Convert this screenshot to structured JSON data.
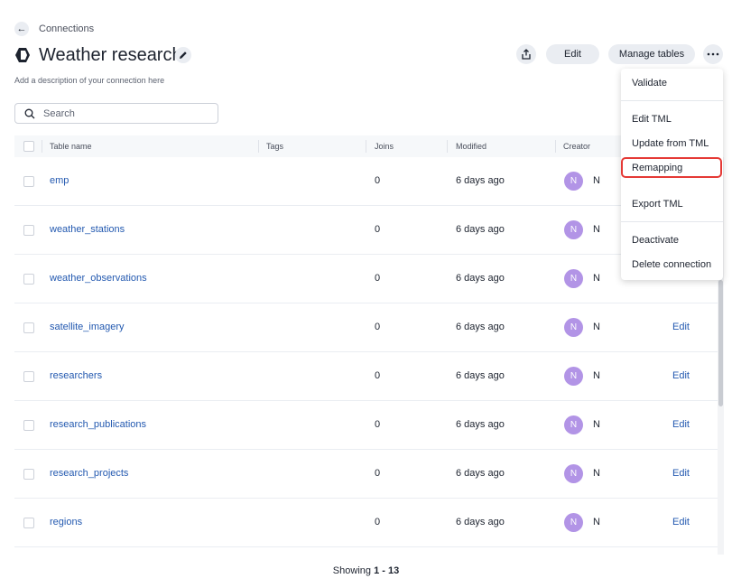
{
  "breadcrumb": {
    "label": "Connections"
  },
  "header": {
    "title": "Weather research",
    "description": "Add a description of your connection here"
  },
  "search": {
    "placeholder": "Search",
    "value": ""
  },
  "actions": {
    "edit_label": "Edit",
    "manage_tables_label": "Manage tables"
  },
  "table": {
    "columns": {
      "name": "Table name",
      "tags": "Tags",
      "joins": "Joins",
      "modified": "Modified",
      "creator": "Creator"
    },
    "rows": [
      {
        "name": "emp",
        "joins": "0",
        "modified": "6 days ago",
        "creator_initial": "N",
        "creator": "N",
        "action": ""
      },
      {
        "name": "weather_stations",
        "joins": "0",
        "modified": "6 days ago",
        "creator_initial": "N",
        "creator": "N",
        "action": ""
      },
      {
        "name": "weather_observations",
        "joins": "0",
        "modified": "6 days ago",
        "creator_initial": "N",
        "creator": "N",
        "action": ""
      },
      {
        "name": "satellite_imagery",
        "joins": "0",
        "modified": "6 days ago",
        "creator_initial": "N",
        "creator": "N",
        "action": "Edit"
      },
      {
        "name": "researchers",
        "joins": "0",
        "modified": "6 days ago",
        "creator_initial": "N",
        "creator": "N",
        "action": "Edit"
      },
      {
        "name": "research_publications",
        "joins": "0",
        "modified": "6 days ago",
        "creator_initial": "N",
        "creator": "N",
        "action": "Edit"
      },
      {
        "name": "research_projects",
        "joins": "0",
        "modified": "6 days ago",
        "creator_initial": "N",
        "creator": "N",
        "action": "Edit"
      },
      {
        "name": "regions",
        "joins": "0",
        "modified": "6 days ago",
        "creator_initial": "N",
        "creator": "N",
        "action": "Edit"
      }
    ]
  },
  "footer": {
    "prefix": "Showing",
    "range": "1 - 13"
  },
  "menu": {
    "items": [
      {
        "label": "Validate"
      },
      {
        "label": "Edit TML"
      },
      {
        "label": "Update from TML"
      },
      {
        "label": "Remapping"
      },
      {
        "label": "Export TML"
      },
      {
        "label": "Deactivate"
      },
      {
        "label": "Delete connection"
      }
    ]
  },
  "colors": {
    "link": "#2359b0",
    "avatar": "#b294e6",
    "highlight": "#e53935"
  }
}
